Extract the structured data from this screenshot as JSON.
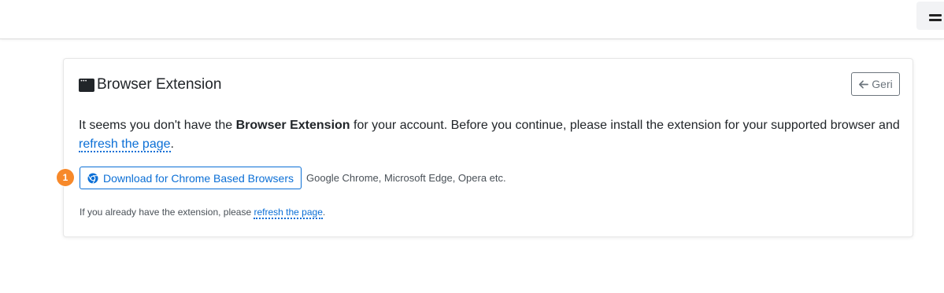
{
  "header": {
    "menu_icon": "hamburger-icon"
  },
  "card": {
    "icon": "browser-window-icon",
    "title": "Browser Extension",
    "back_button": {
      "icon": "arrow-left-icon",
      "label": "Geri"
    }
  },
  "message": {
    "part1": "It seems you don't have the ",
    "bold": "Browser Extension",
    "part2": " for your account. Before you continue, please install the extension for your supported browser and ",
    "link": "refresh the page",
    "part3": "."
  },
  "download": {
    "step_number": "1",
    "button_icon": "chrome-icon",
    "button_label": "Download for Chrome Based Browsers",
    "browsers_text": "Google Chrome, Microsoft Edge, Opera etc."
  },
  "footnote": {
    "text": "If you already have the extension, please ",
    "link": "refresh the page",
    "end": "."
  },
  "colors": {
    "link": "#0b6fd6",
    "badge": "#f7892a",
    "text": "#212529"
  }
}
